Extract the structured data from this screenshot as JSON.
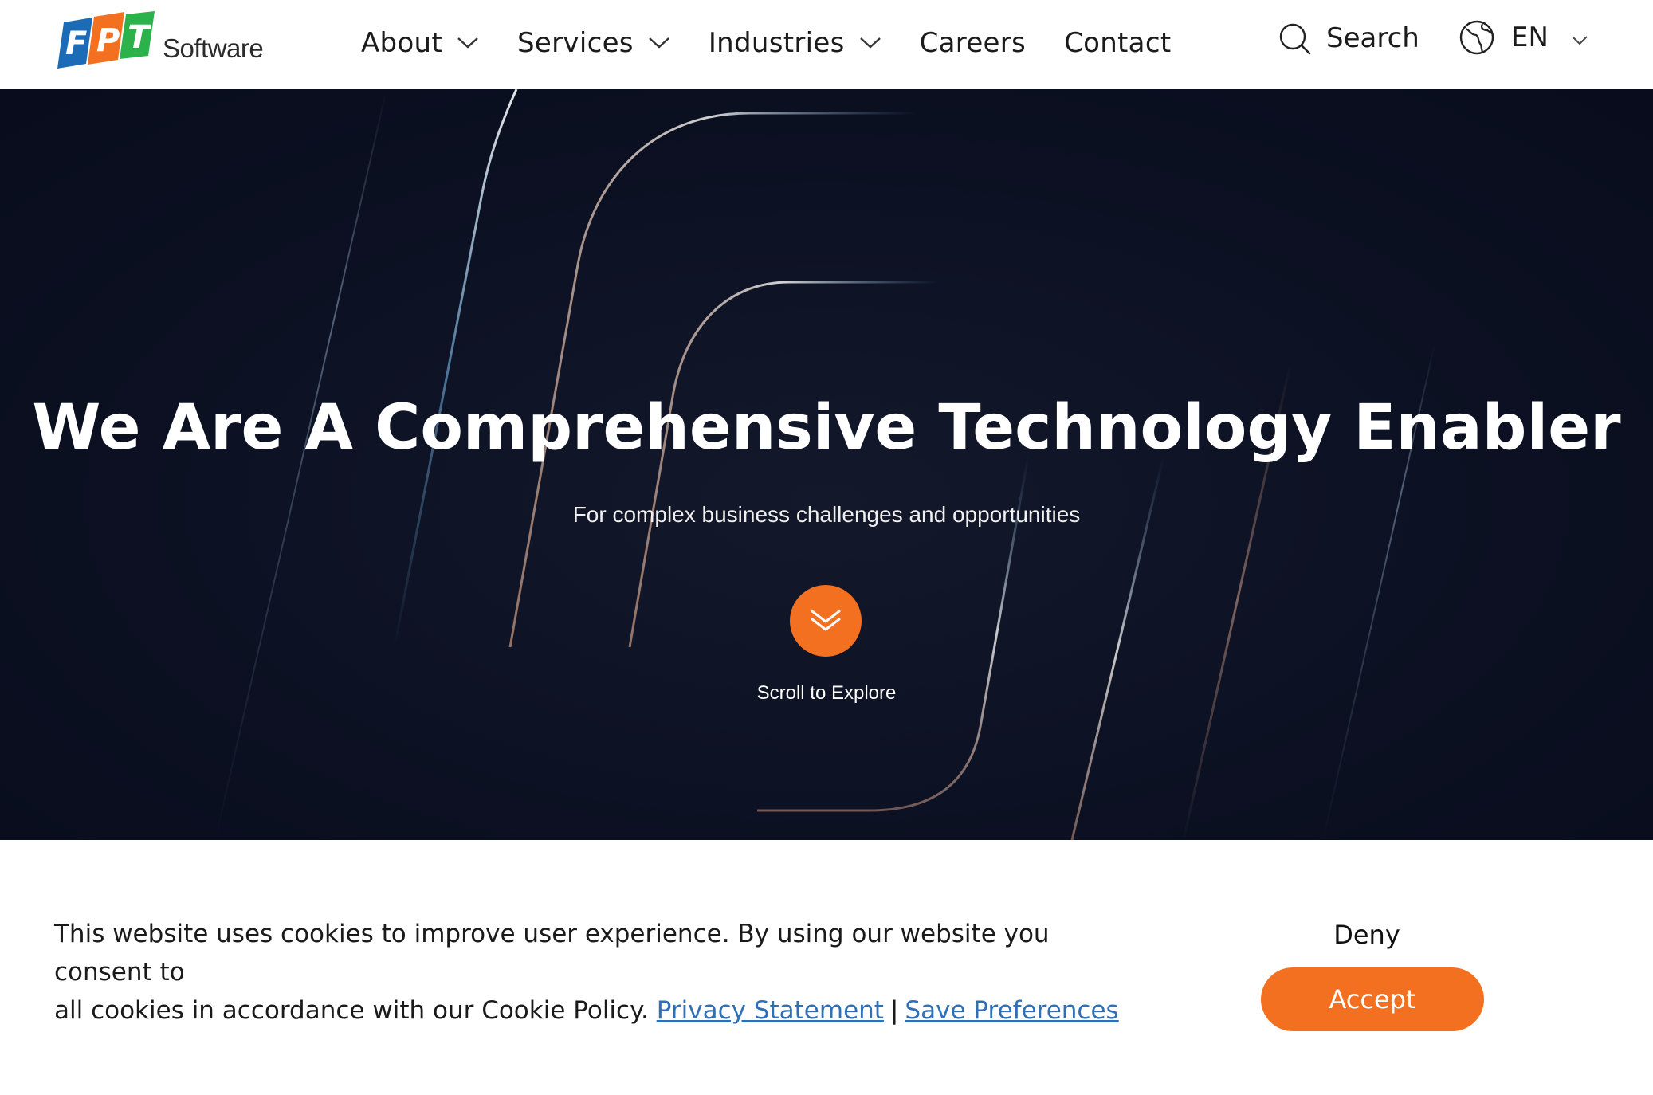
{
  "header": {
    "logo": {
      "letters": [
        "F",
        "P",
        "T"
      ],
      "wordmark": "Software",
      "colors": [
        "#1c6bb6",
        "#f37021",
        "#2cb24a"
      ]
    },
    "nav": [
      {
        "label": "About",
        "has_dropdown": true
      },
      {
        "label": "Services",
        "has_dropdown": true
      },
      {
        "label": "Industries",
        "has_dropdown": true
      },
      {
        "label": "Careers",
        "has_dropdown": false
      },
      {
        "label": "Contact",
        "has_dropdown": false
      }
    ],
    "search_label": "Search",
    "language": "EN",
    "icons": {
      "search": "search-icon",
      "language": "globe-icon",
      "dropdown": "chevron-down-icon"
    }
  },
  "hero": {
    "title": "We Are A Comprehensive Technology Enabler",
    "subtitle": "For complex business challenges and opportunities",
    "scroll_label": "Scroll to Explore",
    "scroll_icon": "double-chevron-down-icon",
    "background": "#0d1224",
    "accent": "#f37021"
  },
  "cookie_banner": {
    "text_line1": "This website uses cookies to improve user experience. By using our website you consent to",
    "text_line2": "all cookies in accordance with our Cookie Policy.",
    "privacy_link": "Privacy Statement",
    "separator": "|",
    "preferences_link": "Save Preferences",
    "deny_label": "Deny",
    "accept_label": "Accept",
    "link_color": "#2f6fb6",
    "accept_color": "#f37021"
  }
}
